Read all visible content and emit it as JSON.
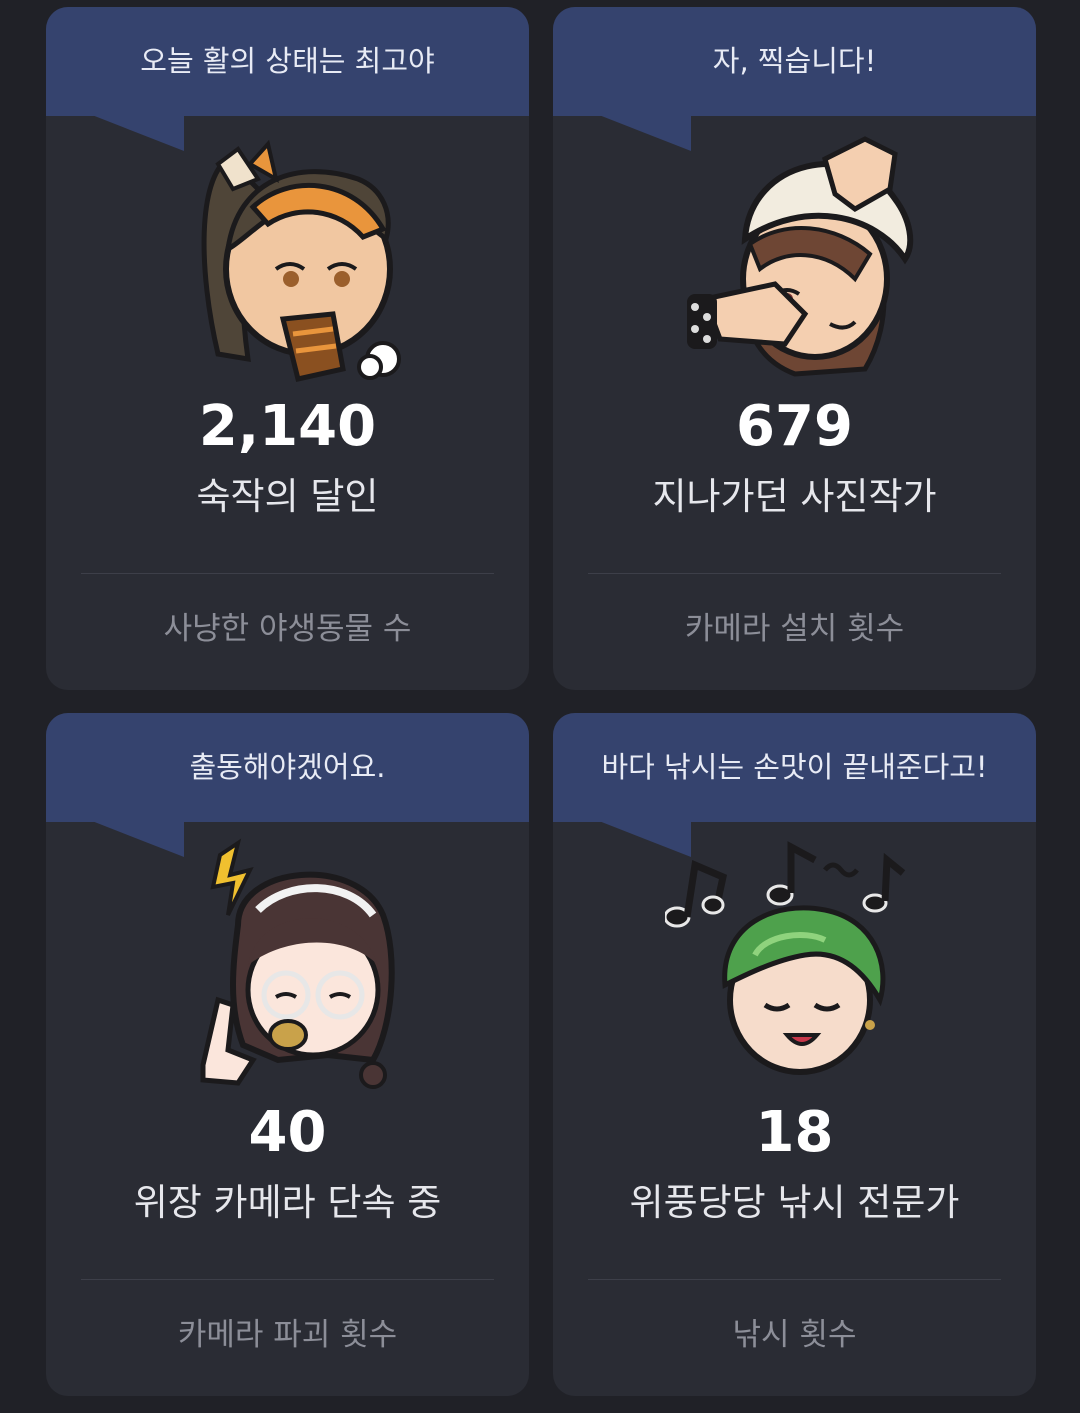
{
  "cards": [
    {
      "speech": "오늘 활의 상태는 최고야",
      "value": "2,140",
      "title": "숙작의 달인",
      "metric": "사냥한 야생동물 수",
      "character": "archer-girl-orange-headband-icon"
    },
    {
      "speech": "자, 찍습니다!",
      "value": "679",
      "title": "지나가던 사진작가",
      "metric": "카메라 설치 횟수",
      "character": "photographer-girl-white-cap-icon"
    },
    {
      "speech": "출동해야겠어요.",
      "value": "40",
      "title": "위장 카메라 단속 중",
      "metric": "카메라 파괴 횟수",
      "character": "girl-glasses-whistle-icon"
    },
    {
      "speech": "바다 낚시는 손맛이 끝내준다고!",
      "value": "18",
      "title": "위풍당당 낚시 전문가",
      "metric": "낚시 횟수",
      "character": "green-hair-boy-music-notes-icon"
    }
  ],
  "colors": {
    "background": "#202127",
    "card": "#2a2c34",
    "bubble": "#35436e",
    "value_text": "#ffffff",
    "metric_text": "#8c8e98"
  }
}
